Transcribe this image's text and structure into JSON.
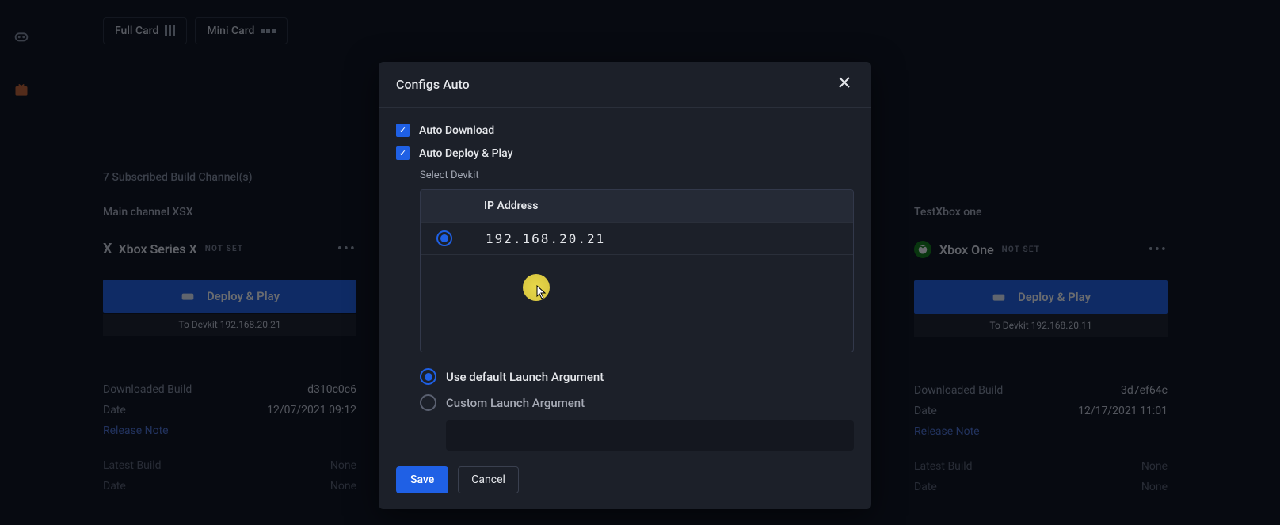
{
  "topbar": {
    "full_card": "Full Card",
    "mini_card": "Mini Card"
  },
  "subscribed_header": "7 Subscribed Build Channel(s)",
  "cards": [
    {
      "title": "Main channel XSX",
      "platform": "Xbox Series X",
      "not_set": "NOT SET",
      "deploy_label": "Deploy & Play",
      "to_devkit": "To Devkit 192.168.20.21",
      "downloaded_build_label": "Downloaded Build",
      "downloaded_build_value": "d310c0c6",
      "date_label": "Date",
      "date_value": "12/07/2021 09:12",
      "release_note": "Release Note",
      "latest_build_label": "Latest Build",
      "latest_build_value": "None",
      "date2_label": "Date",
      "date2_value": "None"
    },
    {
      "title": "TestXbox one",
      "platform": "Xbox One",
      "not_set": "NOT SET",
      "deploy_label": "Deploy & Play",
      "to_devkit": "To Devkit 192.168.20.11",
      "downloaded_build_label": "Downloaded Build",
      "downloaded_build_value": "3d7ef64c",
      "date_label": "Date",
      "date_value": "12/17/2021 11:01",
      "release_note": "Release Note",
      "latest_build_label": "Latest Build",
      "latest_build_value": "None",
      "date2_label": "Date",
      "date2_value": "None"
    }
  ],
  "modal": {
    "title": "Configs Auto",
    "auto_download": "Auto Download",
    "auto_deploy": "Auto Deploy & Play",
    "select_devkit": "Select Devkit",
    "ip_header": "IP Address",
    "devkits": [
      {
        "ip": "192.168.20.21",
        "selected": true
      }
    ],
    "use_default_arg": "Use default Launch Argument",
    "custom_arg": "Custom Launch Argument",
    "custom_arg_value": "",
    "save": "Save",
    "cancel": "Cancel"
  }
}
